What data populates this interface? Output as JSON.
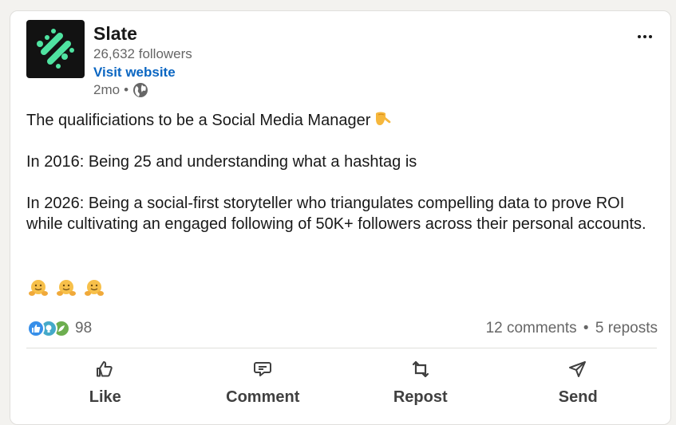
{
  "company": {
    "name": "Slate",
    "followers": "26,632 followers",
    "visit_label": "Visit website",
    "posted": "2mo",
    "separator": "•",
    "logo_icon": "slate-logo-icon",
    "visibility_icon": "globe-icon"
  },
  "post": {
    "line1": "The qualificiations to be a Social Media Manager",
    "line1_emoji": "backhand-index-pointing-down-emoji",
    "line2": "In 2016: Being 25 and understanding what a hashtag is",
    "line3": "In 2026: Being a social-first storyteller who triangulates compelling data to prove ROI while cultivating an engaged following of 50K+ followers across their personal accounts.",
    "trailing_emojis": [
      "hugging-face-emoji",
      "hugging-face-emoji",
      "hugging-face-emoji"
    ]
  },
  "social": {
    "reaction_icons": [
      "like-reaction-icon",
      "insightful-reaction-icon",
      "support-reaction-icon"
    ],
    "reaction_count": "98",
    "comments": "12 comments",
    "separator": "•",
    "reposts": "5 reposts"
  },
  "actions": [
    {
      "label": "Like",
      "icon": "thumbs-up-icon"
    },
    {
      "label": "Comment",
      "icon": "comment-icon"
    },
    {
      "label": "Repost",
      "icon": "repost-icon"
    },
    {
      "label": "Send",
      "icon": "send-icon"
    }
  ],
  "colors": {
    "link": "#0a66c2",
    "logo_background": "#121212",
    "logo_mark": "#4fe3a1",
    "like": "#378fe9",
    "insightful": "#44a9c9",
    "support": "#6dae4f",
    "muted_text": "#666666"
  }
}
